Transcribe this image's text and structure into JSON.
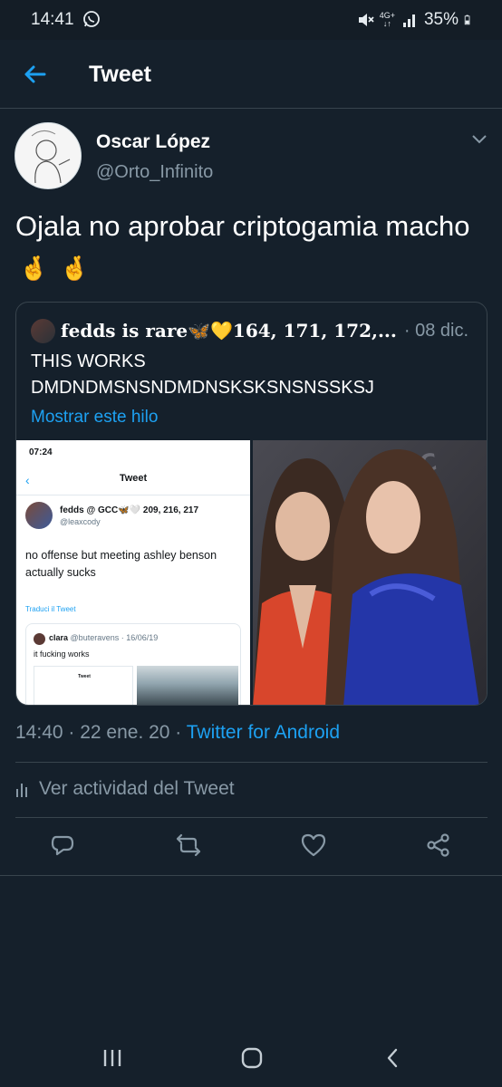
{
  "status_bar": {
    "time": "14:41",
    "network": "4G+",
    "battery": "35%",
    "icons": [
      "whatsapp-icon",
      "mute-icon",
      "signal-icon",
      "battery-icon"
    ]
  },
  "header": {
    "title": "Tweet",
    "back_icon": "arrow-left-icon"
  },
  "tweet": {
    "author_name": "Oscar López",
    "author_handle": "@Orto_Infinito",
    "text": "Ojala no aprobar criptogamia macho",
    "emojis": [
      "🤞",
      "🤞"
    ],
    "timestamp": "14:40 · 22 ene. 20 · ",
    "source": "Twitter for Android",
    "activity_label": "Ver actividad del Tweet"
  },
  "quote": {
    "name": "fedds is rare🦋💛164, 171, 172,...",
    "date": "· 08 dic. 19",
    "text": "THIS WORKS\nDMDNDMSNSNDMDNSKSKSNSNSSKSJ",
    "link": "Mostrar este hilo",
    "screenshot": {
      "time": "07:24",
      "title": "Tweet",
      "name": "fedds @ GCC🦋🤍 209, 216, 217",
      "handle": "@leaxcody",
      "body": "no offense but meeting ashley benson actually sucks",
      "translate": "Traduci il Tweet",
      "quote_name": "clara",
      "quote_handle": "@buteravens · 16/06/19",
      "quote_text": "it fucking works",
      "mini_title": "Tweet"
    }
  },
  "actions": [
    "reply-icon",
    "retweet-icon",
    "like-icon",
    "share-icon"
  ],
  "colors": {
    "background": "#15202b",
    "accent": "#1da1f2",
    "secondary_text": "#8899a6",
    "border": "#38444d"
  }
}
